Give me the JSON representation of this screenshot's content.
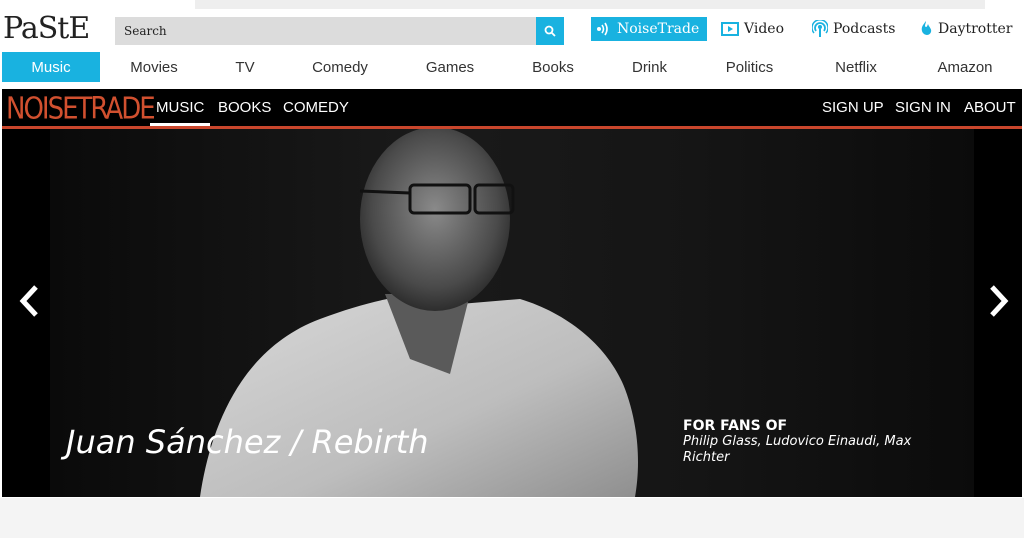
{
  "header": {
    "logo": "PaStE",
    "search_placeholder": "Search",
    "noisetrade_label": "NoiseTrade",
    "links": [
      {
        "label": "Video",
        "icon": "video-icon"
      },
      {
        "label": "Podcasts",
        "icon": "podcast-icon"
      },
      {
        "label": "Daytrotter",
        "icon": "daytrotter-icon"
      }
    ]
  },
  "categories": [
    "Music",
    "Movies",
    "TV",
    "Comedy",
    "Games",
    "Books",
    "Drink",
    "Politics",
    "Netflix",
    "Amazon"
  ],
  "active_category": "Music",
  "noisetrade": {
    "logo": "NOISETRADE",
    "nav": [
      "MUSIC",
      "BOOKS",
      "COMEDY"
    ],
    "active_nav": "MUSIC",
    "account": [
      "SIGN UP",
      "SIGN IN",
      "ABOUT"
    ]
  },
  "hero": {
    "title": "Juan Sánchez / Rebirth",
    "fans_label": "FOR FANS OF",
    "fans_names": "Philip Glass, Ludovico Einaudi, Max Richter"
  },
  "colors": {
    "accent_blue": "#19b2e0",
    "noisetrade_orange": "#c9462c"
  }
}
